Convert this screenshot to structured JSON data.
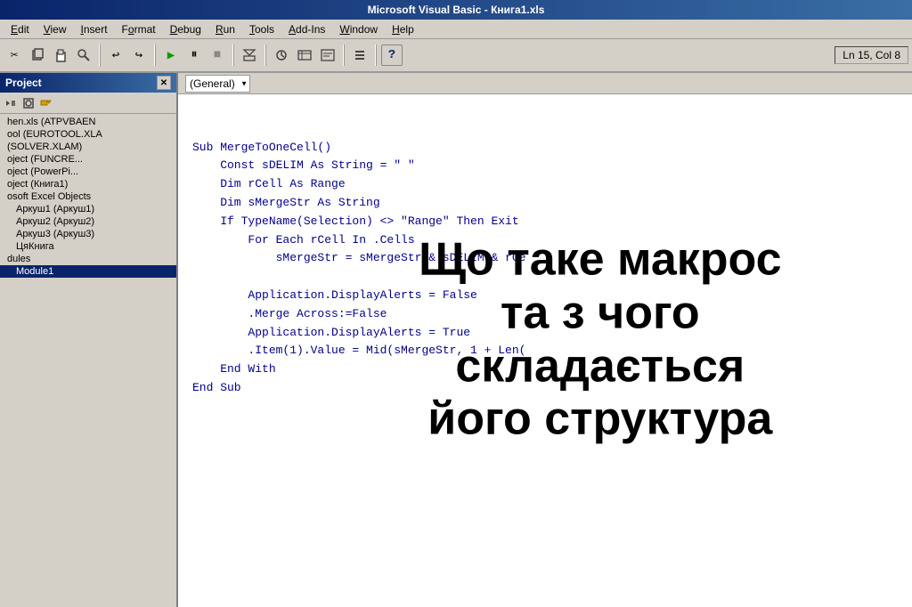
{
  "titlebar": {
    "text": "Microsoft Visual Basic - Книга1.xls"
  },
  "menubar": {
    "items": [
      {
        "label": "Edit",
        "underline": "E"
      },
      {
        "label": "View",
        "underline": "V"
      },
      {
        "label": "Insert",
        "underline": "I"
      },
      {
        "label": "Format",
        "underline": "o"
      },
      {
        "label": "Debug",
        "underline": "D"
      },
      {
        "label": "Run",
        "underline": "R"
      },
      {
        "label": "Tools",
        "underline": "T"
      },
      {
        "label": "Add-Ins",
        "underline": "A"
      },
      {
        "label": "Window",
        "underline": "W"
      },
      {
        "label": "Help",
        "underline": "H"
      }
    ]
  },
  "toolbar": {
    "status": "Ln 15, Col 8",
    "buttons": [
      {
        "icon": "✂",
        "name": "cut-icon"
      },
      {
        "icon": "⧉",
        "name": "copy-icon"
      },
      {
        "icon": "📋",
        "name": "paste-icon"
      },
      {
        "icon": "🔍",
        "name": "find-icon"
      },
      {
        "icon": "↩",
        "name": "undo-icon"
      },
      {
        "icon": "↪",
        "name": "redo-icon"
      },
      {
        "icon": "▶",
        "name": "run-icon"
      },
      {
        "icon": "⏸",
        "name": "pause-icon"
      },
      {
        "icon": "⏹",
        "name": "stop-icon"
      },
      {
        "icon": "✏",
        "name": "edit-icon"
      },
      {
        "icon": "🔧",
        "name": "watch-icon"
      },
      {
        "icon": "📊",
        "name": "locals-icon"
      },
      {
        "icon": "📋",
        "name": "immediate-icon"
      },
      {
        "icon": "✂",
        "name": "cut2-icon"
      },
      {
        "icon": "❓",
        "name": "help-icon"
      }
    ]
  },
  "sidebar": {
    "title": "Project",
    "items": [
      {
        "label": "hen.xls (ATPVBAEN",
        "indent": false
      },
      {
        "label": "ool (EUROTOOL.XLA",
        "indent": false
      },
      {
        "label": "(SOLVER.XLAM)",
        "indent": false
      },
      {
        "label": "oject (FUNCRE...",
        "indent": false
      },
      {
        "label": "oject (PowerPi...",
        "indent": false
      },
      {
        "label": "oject (Книга1)",
        "indent": false
      },
      {
        "label": "osoft Excel Objects",
        "indent": false
      },
      {
        "label": "Аркуш1 (Аркуш1)",
        "indent": true
      },
      {
        "label": "Аркуш2 (Аркуш2)",
        "indent": true
      },
      {
        "label": "Аркуш3 (Аркуш3)",
        "indent": true
      },
      {
        "label": "ЦяКнига",
        "indent": true
      },
      {
        "label": "dules",
        "indent": false
      },
      {
        "label": "Module1",
        "indent": true
      }
    ]
  },
  "code_editor": {
    "dropdown_value": "(General)",
    "lines": [
      "",
      "Sub MergeToOneCell()",
      "    Const sDELIM As String = \" \"",
      "    Dim rCell As Range",
      "    Dim sMergeStr As String",
      "    If TypeName(Selection) <> \"Range\" Then Exit",
      "        For Each rCell In .Cells",
      "            sMergeStr = sMergeStr & sDELIM & rCe",
      "",
      "        Application.DisplayAlerts = False",
      "        .Merge Across:=False",
      "        Application.DisplayAlerts = True",
      "        .Item(1).Value = Mid(sMergeStr, 1 + Len(",
      "    End With",
      "End Sub"
    ]
  },
  "overlay": {
    "line1": "Що таке макрос та з чого",
    "line2": "складається його структура"
  }
}
